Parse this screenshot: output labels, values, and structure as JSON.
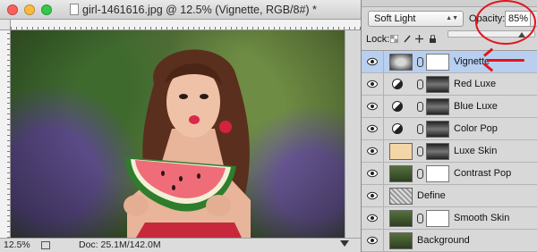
{
  "window": {
    "title": "girl-1461616.jpg @ 12.5% (Vignette, RGB/8#) *"
  },
  "status_bar": {
    "zoom": "12.5%",
    "doc_size": "Doc: 25.1M/142.0M"
  },
  "layers_panel": {
    "blend_mode": "Soft Light",
    "opacity_label": "Opacity:",
    "opacity_value": "85%",
    "opacity_fraction": 0.85,
    "lock_label": "Lock:",
    "layers": [
      {
        "name": "Vignette",
        "type": "vignette",
        "selected": true
      },
      {
        "name": "Red Luxe",
        "type": "adjustment"
      },
      {
        "name": "Blue Luxe",
        "type": "adjustment"
      },
      {
        "name": "Color Pop",
        "type": "adjustment"
      },
      {
        "name": "Luxe Skin",
        "type": "skin"
      },
      {
        "name": "Contrast Pop",
        "type": "photo-mask"
      },
      {
        "name": "Define",
        "type": "define"
      },
      {
        "name": "Smooth Skin",
        "type": "photo-mask"
      },
      {
        "name": "Background",
        "type": "photo"
      }
    ]
  },
  "colors": {
    "annotation": "#e3141c",
    "selected_layer": "#b8cff0"
  }
}
